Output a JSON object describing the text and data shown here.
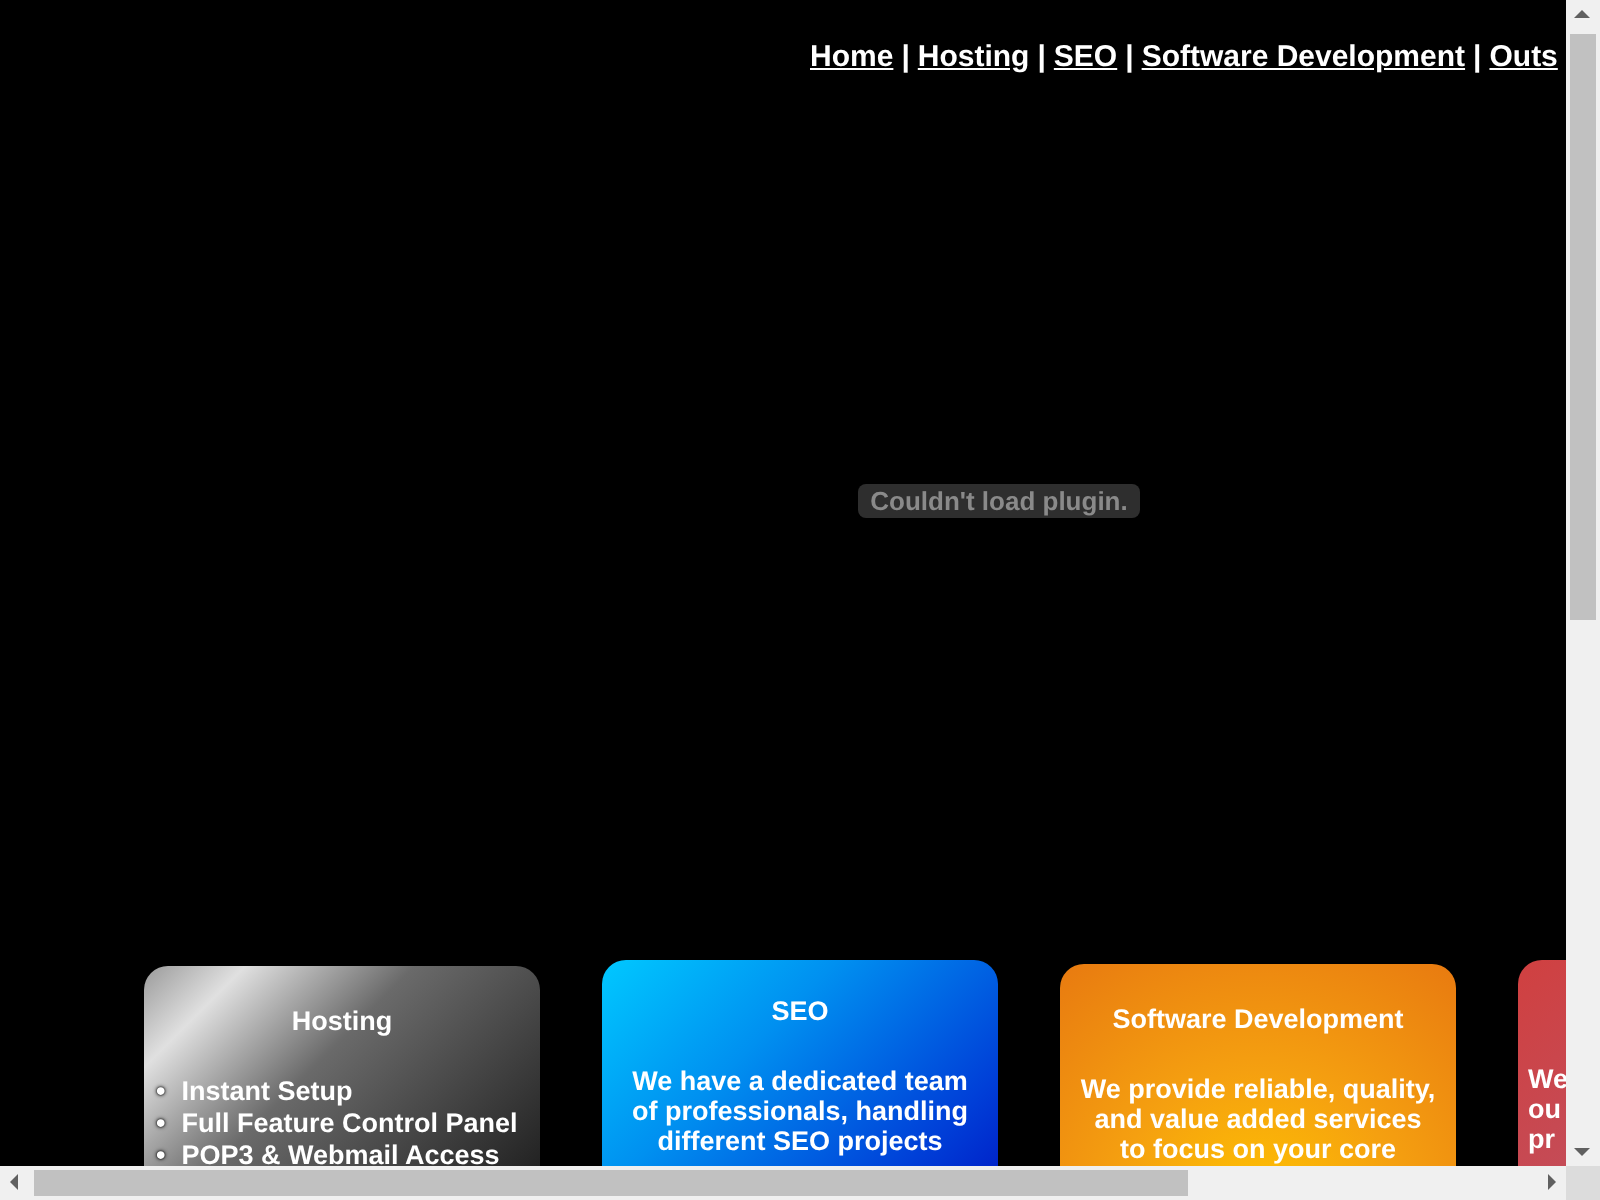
{
  "nav": {
    "separator": "|",
    "links": [
      "Home",
      "Hosting",
      "SEO",
      "Software Development",
      "Outs"
    ]
  },
  "plugin": {
    "message": "Couldn't load plugin."
  },
  "cards": [
    {
      "kind": "list",
      "title": "Hosting",
      "marker": "•",
      "items": [
        "Instant Setup",
        "Full Feature Control Panel",
        "POP3 & Webmail Access"
      ]
    },
    {
      "kind": "text",
      "title": "SEO",
      "lines": [
        "We have a dedicated team",
        "of professionals, handling",
        "different SEO projects"
      ]
    },
    {
      "kind": "text",
      "title": "Software Development",
      "lines": [
        "We provide reliable, quality,",
        "and value added services",
        "to focus on your core"
      ]
    },
    {
      "kind": "partial",
      "lines": [
        "We",
        "ou",
        "pr"
      ]
    }
  ]
}
